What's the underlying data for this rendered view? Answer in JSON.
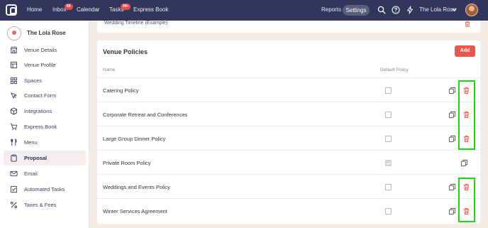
{
  "topbar": {
    "nav": [
      {
        "label": "Home"
      },
      {
        "label": "Inbox",
        "badge": "68"
      },
      {
        "label": "Calendar"
      },
      {
        "label": "Tasks",
        "badge": "99+"
      },
      {
        "label": "Express Book"
      }
    ],
    "reports_label": "Reports",
    "settings_label": "Settings",
    "account_name": "The Lola Rose"
  },
  "sidebar": {
    "venue_name": "The Lola Rose",
    "items": [
      {
        "label": "Venue Details",
        "icon": "store-icon"
      },
      {
        "label": "Venue Profile",
        "icon": "layout-icon"
      },
      {
        "label": "Spaces",
        "icon": "grid-icon"
      },
      {
        "label": "Contact Form",
        "icon": "cursor-icon"
      },
      {
        "label": "Integrations",
        "icon": "cube-icon"
      },
      {
        "label": "Express Book",
        "icon": "cart-icon"
      },
      {
        "label": "Menu",
        "icon": "utensils-icon"
      },
      {
        "label": "Proposal",
        "icon": "clipboard-icon",
        "active": true
      },
      {
        "label": "Email",
        "icon": "mail-icon"
      },
      {
        "label": "Automated Tasks",
        "icon": "checkbox-icon"
      },
      {
        "label": "Taxes & Fees",
        "icon": "percent-icon"
      }
    ]
  },
  "previous_item": {
    "name": "Wedding Timeline (Example)"
  },
  "policies": {
    "title": "Venue Policies",
    "add_label": "Add",
    "col_name": "Name",
    "col_default": "Default Policy",
    "rows": [
      {
        "name": "Catering Policy",
        "default": false,
        "deletable": true
      },
      {
        "name": "Corporate Retreat and Conferences",
        "default": false,
        "deletable": true
      },
      {
        "name": "Large Group Dinner Policy",
        "default": false,
        "deletable": true
      },
      {
        "name": "Private Room Policy",
        "default": true,
        "deletable": false
      },
      {
        "name": "Weddings and Events Policy",
        "default": false,
        "deletable": true
      },
      {
        "name": "Winter Services Agreement",
        "default": false,
        "deletable": true
      }
    ]
  },
  "colors": {
    "topbar": "#33365b",
    "accent_red": "#e8574d",
    "highlight_green": "#22d31a"
  }
}
